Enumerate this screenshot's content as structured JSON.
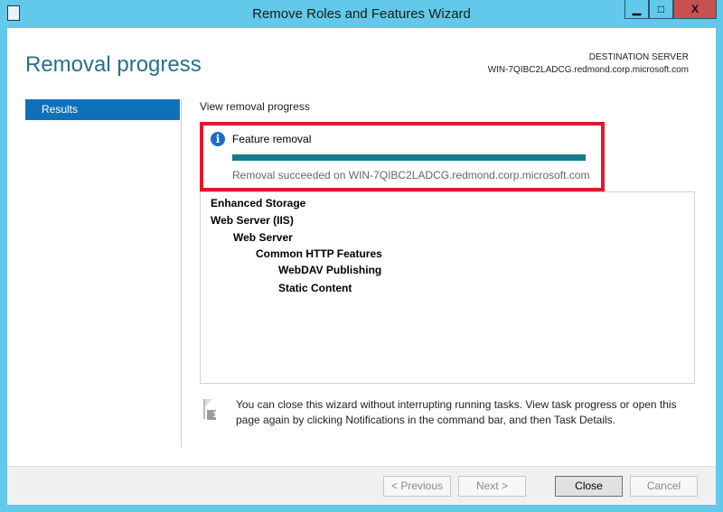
{
  "window": {
    "title": "Remove Roles and Features Wizard",
    "minimize": "▁",
    "maximize": "□",
    "close": "X"
  },
  "header": {
    "page_title": "Removal progress",
    "destination_label": "DESTINATION SERVER",
    "destination_server": "WIN-7QIBC2LADCG.redmond.corp.microsoft.com"
  },
  "sidebar": {
    "items": [
      {
        "label": "Results"
      }
    ]
  },
  "main": {
    "subtitle": "View removal progress",
    "status": {
      "icon": "info-icon",
      "title": "Feature removal",
      "progress_percent": 100,
      "message": "Removal succeeded on WIN-7QIBC2LADCG.redmond.corp.microsoft.com"
    },
    "features": [
      {
        "label": "Enhanced Storage",
        "level": 0
      },
      {
        "label": "Web Server (IIS)",
        "level": 0
      },
      {
        "label": "Web Server",
        "level": 1
      },
      {
        "label": "Common HTTP Features",
        "level": 2
      },
      {
        "label": "WebDAV Publishing",
        "level": 3
      },
      {
        "label": "Static Content",
        "level": 3
      }
    ],
    "note": "You can close this wizard without interrupting running tasks. View task progress or open this page again by clicking Notifications in the command bar, and then Task Details.",
    "note_badge": "1"
  },
  "footer": {
    "previous": "< Previous",
    "next": "Next >",
    "close": "Close",
    "cancel": "Cancel"
  },
  "colors": {
    "accent": "#0f71ba",
    "highlight": "#e0182c",
    "progress": "#177a8f",
    "frame": "#62c9ea"
  }
}
